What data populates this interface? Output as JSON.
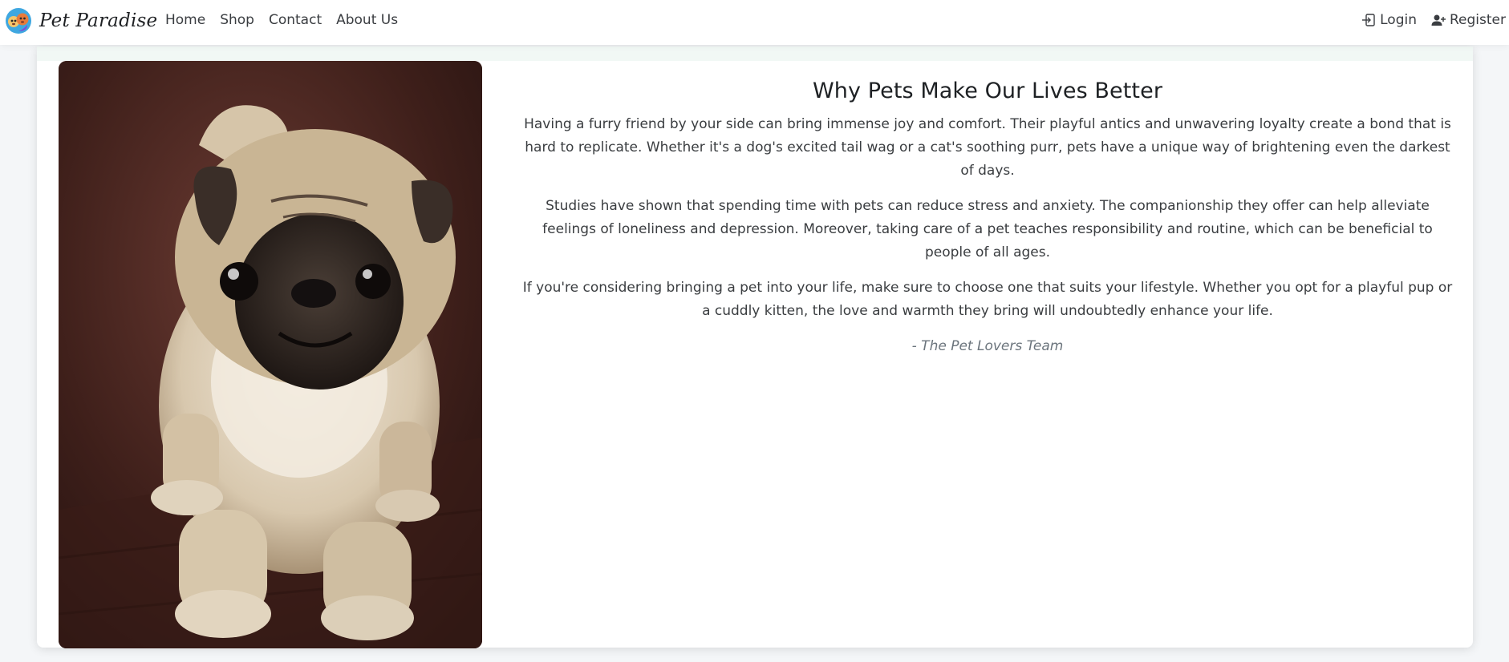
{
  "nav": {
    "brand": "Pet Paradise",
    "links": [
      "Home",
      "Shop",
      "Contact",
      "About Us"
    ],
    "login": "Login",
    "register": "Register"
  },
  "article": {
    "title": "Why Pets Make Our Lives Better",
    "paragraphs": [
      "Having a furry friend by your side can bring immense joy and comfort. Their playful antics and unwavering loyalty create a bond that is hard to replicate. Whether it's a dog's excited tail wag or a cat's soothing purr, pets have a unique way of brightening even the darkest of days.",
      "Studies have shown that spending time with pets can reduce stress and anxiety. The companionship they offer can help alleviate feelings of loneliness and depression. Moreover, taking care of a pet teaches responsibility and routine, which can be beneficial to people of all ages.",
      "If you're considering bringing a pet into your life, make sure to choose one that suits your lifestyle. Whether you opt for a playful pup or a cuddly kitten, the love and warmth they bring will undoubtedly enhance your life."
    ],
    "signature": "- The Pet Lovers Team"
  },
  "icons": {
    "logo": "pets-logo-icon",
    "login": "login-icon",
    "register": "add-user-icon"
  },
  "image": {
    "subject": "pug-puppy-photo"
  },
  "colors": {
    "background": "#f4f6f8",
    "card": "#ffffff",
    "text": "#212529",
    "muted": "#6c757d"
  }
}
